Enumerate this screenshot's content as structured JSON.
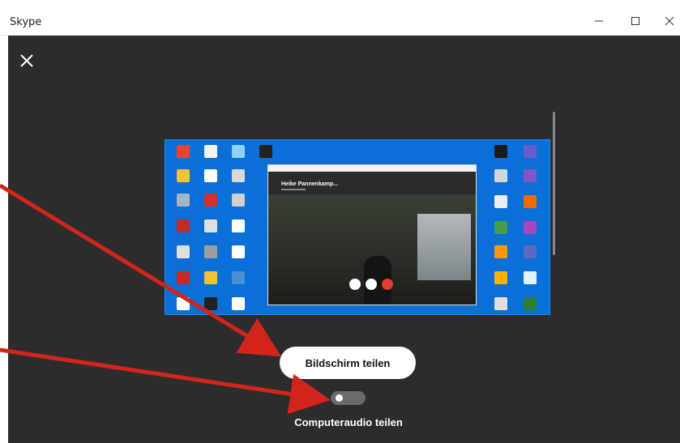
{
  "window": {
    "title": "Skype",
    "controls": [
      "minimize-icon",
      "maximize-icon",
      "close-icon"
    ]
  },
  "overlay": {
    "close_icon": "close-icon"
  },
  "preview": {
    "caller_name": "Heike Pannenkamp..."
  },
  "actions": {
    "share_screen_label": "Bildschirm teilen",
    "share_audio_label": "Computeraudio teilen",
    "share_audio_enabled": false
  },
  "annotations": {
    "arrow_color": "#d3241c"
  },
  "colors": {
    "background": "#2b2b2b",
    "desktop_blue": "#0a6fd6",
    "button": "#ffffff",
    "toggle_off": "#6a6a6a",
    "end_call": "#e23b2e"
  }
}
